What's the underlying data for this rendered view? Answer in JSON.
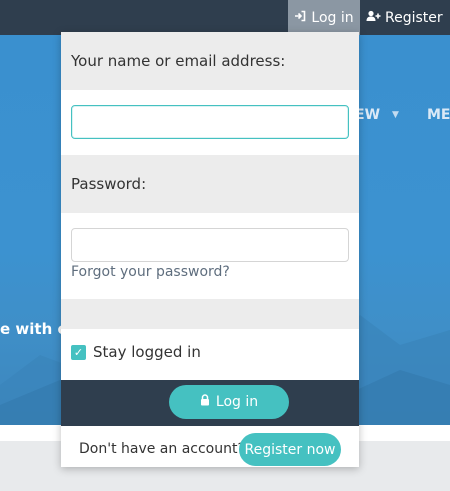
{
  "topbar": {
    "login_label": "Log in",
    "register_label": "Register",
    "login_icon": "sign-in-icon",
    "register_icon": "user-plus-icon"
  },
  "hero": {
    "nav_item_1": "EW",
    "nav_item_2": "MEN",
    "text_fragment": "e with oth"
  },
  "login_panel": {
    "username_label": "Your name or email address:",
    "username_value": "",
    "password_label": "Password:",
    "password_value": "",
    "forgot_password": "Forgot your password?",
    "stay_logged_in": "Stay logged in",
    "stay_logged_in_checked": true,
    "submit_label": "Log in",
    "submit_icon": "lock-icon",
    "no_account_text": "Don't have an account?",
    "register_now_label": "Register now"
  },
  "colors": {
    "accent": "#45c1c1",
    "topbar": "#2f3e4e",
    "hero": "#3c92d0"
  }
}
